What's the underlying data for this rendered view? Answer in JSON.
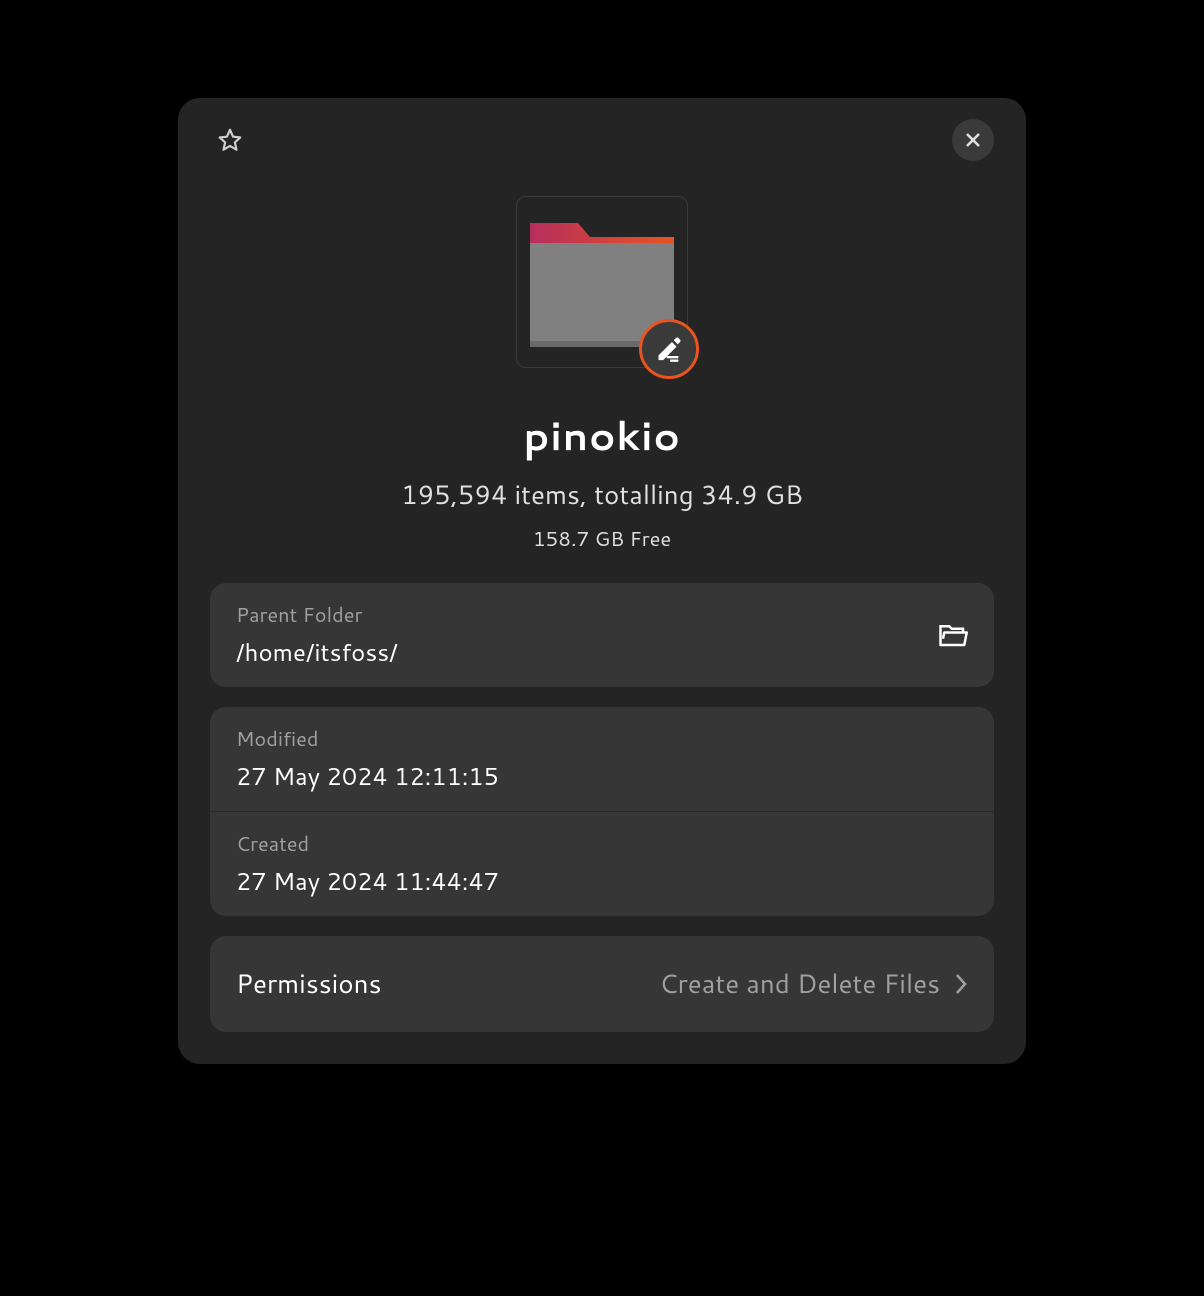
{
  "header": {
    "folder_name": "pinokio",
    "summary": "195,594 items, totalling 34.9 GB",
    "free_space": "158.7 GB Free"
  },
  "parent_folder": {
    "label": "Parent Folder",
    "path": "/home/itsfoss/"
  },
  "modified": {
    "label": "Modified",
    "value": "27 May 2024 12:11:15"
  },
  "created": {
    "label": "Created",
    "value": "27 May 2024 11:44:47"
  },
  "permissions": {
    "label": "Permissions",
    "value": "Create and Delete Files"
  }
}
